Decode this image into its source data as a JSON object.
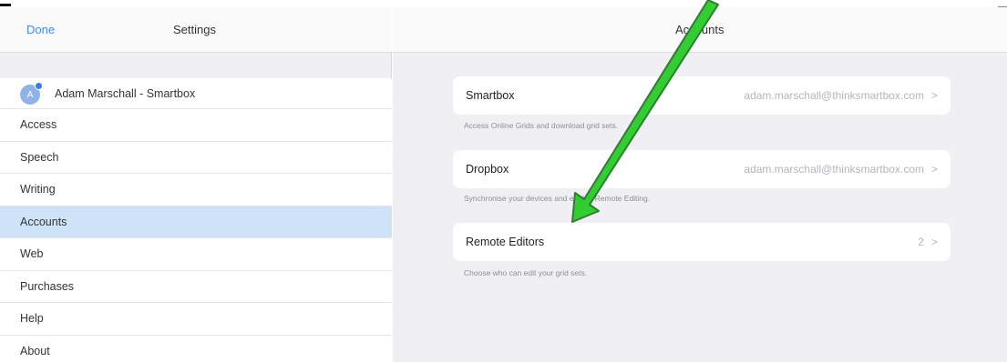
{
  "left_header": {
    "done_label": "Done",
    "title": "Settings"
  },
  "profile": {
    "initial": "A",
    "name": "Adam Marschall - Smartbox"
  },
  "menu": [
    {
      "label": "Access"
    },
    {
      "label": "Speech"
    },
    {
      "label": "Writing"
    },
    {
      "label": "Accounts",
      "selected": true
    },
    {
      "label": "Web"
    },
    {
      "label": "Purchases"
    },
    {
      "label": "Help"
    },
    {
      "label": "About"
    }
  ],
  "right_header": {
    "title": "Accounts"
  },
  "accounts": {
    "smartbox": {
      "label": "Smartbox",
      "value": "adam.marschall@thinksmartbox.com",
      "chevron": ">",
      "caption": "Access Online Grids and download grid sets."
    },
    "dropbox": {
      "label": "Dropbox",
      "value": "adam.marschall@thinksmartbox.com",
      "chevron": ">",
      "caption": "Synchronise your devices and enable Remote Editing."
    },
    "remote_editors": {
      "label": "Remote Editors",
      "value": "2",
      "chevron": ">",
      "caption": "Choose who can edit your grid sets."
    }
  },
  "colors": {
    "accent": "#3b8cf0",
    "selected_row": "#cfe3f8",
    "panel_bg": "#efeff4",
    "arrow_fill": "#33cc33",
    "arrow_outline": "#2e7d32"
  },
  "overlay": {
    "annotation": "green-arrow-pointing-to-remote-editors"
  }
}
